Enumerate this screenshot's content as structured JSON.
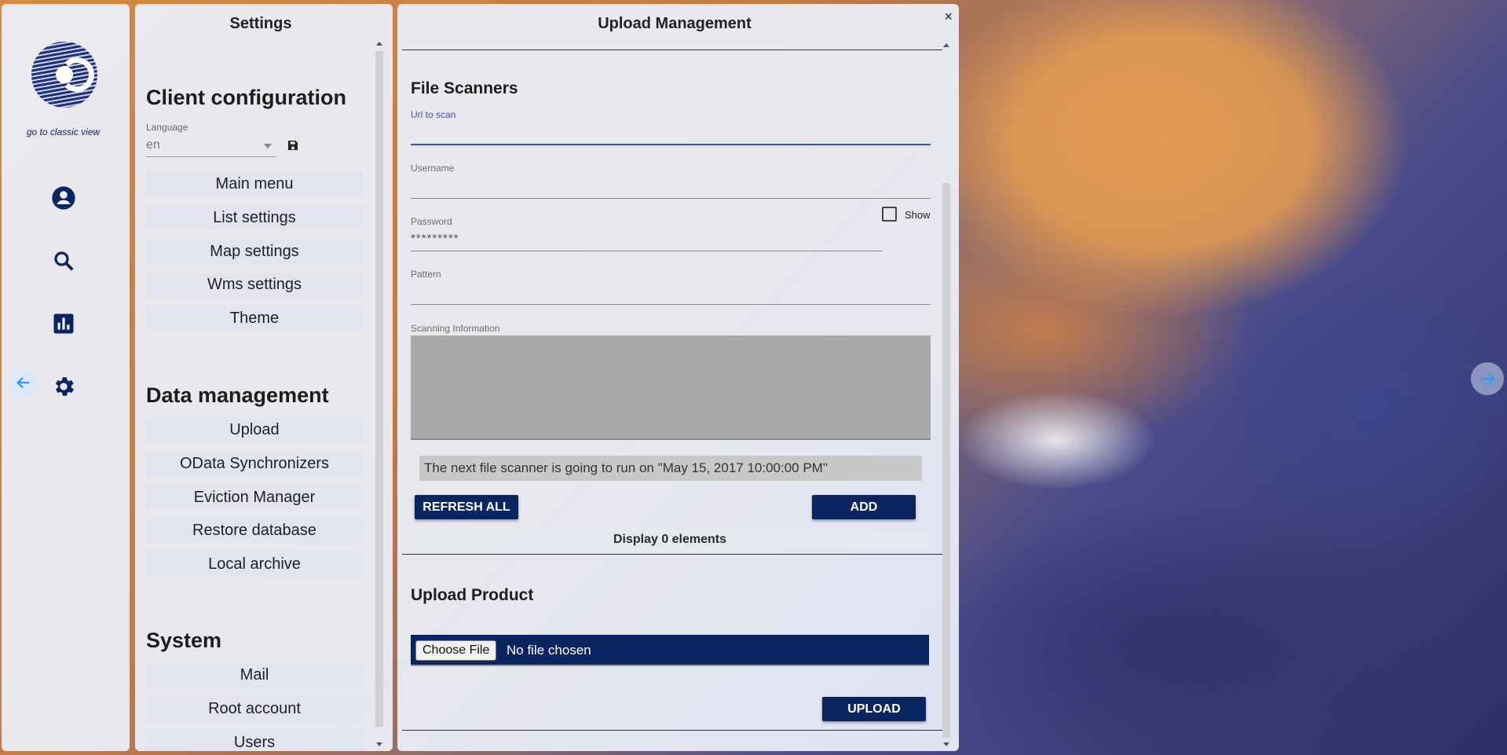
{
  "rail": {
    "classic_link": "go to classic view"
  },
  "settings": {
    "title": "Settings",
    "client_config": {
      "heading": "Client configuration",
      "language_label": "Language",
      "language_value": "en",
      "items": [
        "Main menu",
        "List settings",
        "Map settings",
        "Wms settings",
        "Theme"
      ]
    },
    "data_management": {
      "heading": "Data management",
      "items": [
        "Upload",
        "OData Synchronizers",
        "Eviction Manager",
        "Restore database",
        "Local archive"
      ]
    },
    "system": {
      "heading": "System",
      "items": [
        "Mail",
        "Root account",
        "Users"
      ]
    }
  },
  "upload": {
    "title": "Upload Management",
    "close": "×",
    "file_scanners": {
      "heading": "File Scanners",
      "url_label": "Url to scan",
      "url_value": "",
      "username_label": "Username",
      "username_value": "",
      "password_label": "Password",
      "password_value": "*********",
      "show_label": "Show",
      "pattern_label": "Pattern",
      "pattern_value": "",
      "scanning_info_label": "Scanning Information",
      "next_run_text": "The next file scanner is going to run on \"May 15, 2017 10:00:00 PM\"",
      "refresh_all": "REFRESH ALL",
      "add": "ADD",
      "display_count": "Display 0 elements"
    },
    "upload_product": {
      "heading": "Upload Product",
      "choose_file": "Choose File",
      "no_file": "No file chosen",
      "upload": "UPLOAD"
    }
  },
  "colors": {
    "primary": "#0b2561",
    "accent_blue": "#3a55b4",
    "arrow_blue": "#2a9df4"
  }
}
